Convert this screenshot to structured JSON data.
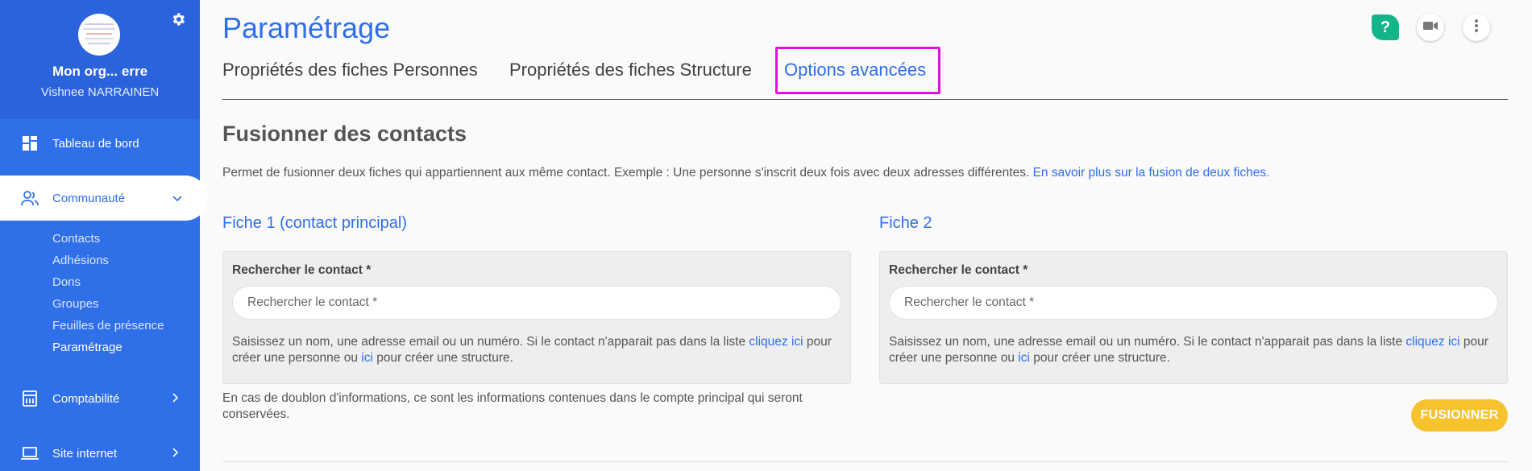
{
  "sidebar": {
    "org_name": "Mon org... erre",
    "user_name": "Vishnee NARRAINEN",
    "nav": {
      "dashboard": "Tableau de bord",
      "community": "Communauté",
      "accounting": "Comptabilité",
      "website": "Site internet"
    },
    "sub_items": [
      "Contacts",
      "Adhésions",
      "Dons",
      "Groupes",
      "Feuilles de présence",
      "Paramétrage"
    ]
  },
  "header": {
    "title": "Paramétrage",
    "help_label": "?"
  },
  "tabs": [
    {
      "label": "Propriétés des fiches Personnes"
    },
    {
      "label": "Propriétés des fiches Structure"
    },
    {
      "label": "Options avancées"
    }
  ],
  "merge": {
    "title": "Fusionner des contacts",
    "description": "Permet de fusionner deux fiches qui appartiennent aux même contact. Exemple : Une personne s'inscrit deux fois avec deux adresses différentes.",
    "description_link": "En savoir plus sur la fusion de deux fiches.",
    "card1": {
      "title": "Fiche 1 (contact principal)",
      "label": "Rechercher le contact *",
      "placeholder": "Rechercher le contact *"
    },
    "card2": {
      "title": "Fiche 2",
      "label": "Rechercher le contact *",
      "placeholder": "Rechercher le contact *"
    },
    "help": {
      "part1": "Saisissez un nom, une adresse email ou un numéro. Si le contact n'apparait pas dans la liste ",
      "link1": "cliquez ici",
      "part2": " pour créer une personne ou ",
      "link2": "ici",
      "part3": " pour créer une structure."
    },
    "note": "En cas de doublon d'informations, ce sont les informations contenues dans le compte principal qui seront conservées.",
    "button": "FUSIONNER"
  },
  "colors": {
    "primary": "#2f6fe8",
    "accent_yellow": "#f6c22e",
    "help_green": "#13b48a",
    "highlight": "#e60fe0"
  }
}
